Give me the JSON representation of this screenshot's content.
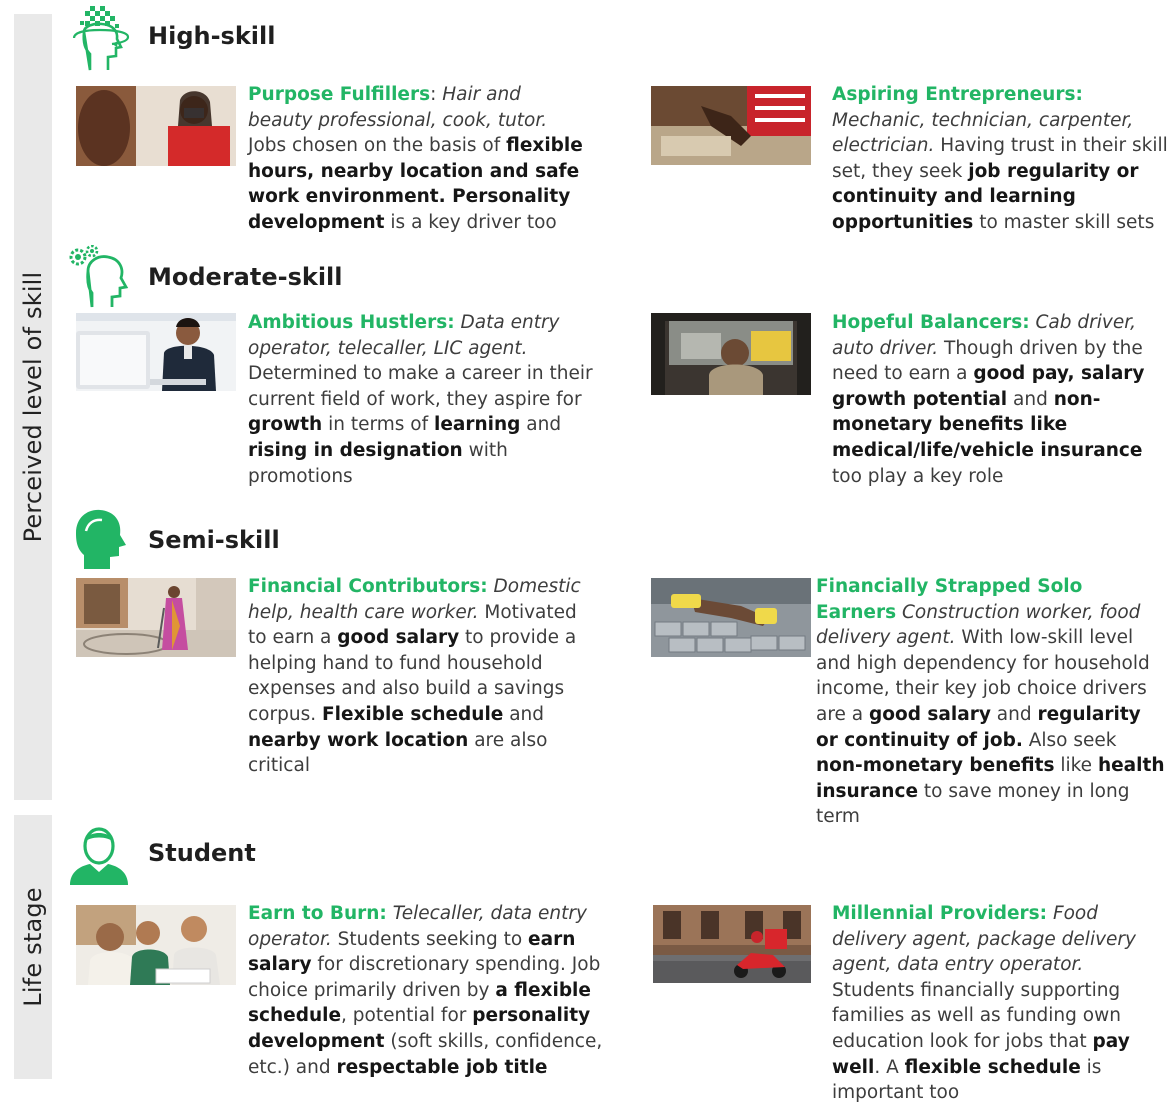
{
  "axis": {
    "skill_label": "Perceived level of skill",
    "life_label": "Life stage"
  },
  "colors": {
    "accent": "#22b565",
    "sidebar": "#e9e9e9",
    "text": "#3d3d3d"
  },
  "sections": [
    {
      "title": "High-skill",
      "icon": "head-pixel-icon",
      "cards": [
        {
          "name": "Purpose Fulfillers",
          "sep": ":",
          "examples": "Hair and beauty professional, cook, tutor.",
          "segments": [
            {
              "t": "Jobs chosen on the basis of ",
              "b": false
            },
            {
              "t": "flexible hours, nearby location and safe work environment. Personality development",
              "b": true
            },
            {
              "t": " is a key driver too",
              "b": false
            }
          ]
        },
        {
          "name": "Aspiring Entrepreneurs:",
          "sep": "",
          "examples": "Mechanic, technician, carpenter, electrician.",
          "segments": [
            {
              "t": "Having trust in their skill set, they seek ",
              "b": false
            },
            {
              "t": "job regularity or continuity and learning opportunities",
              "b": true
            },
            {
              "t": " to master skill sets",
              "b": false
            }
          ]
        }
      ]
    },
    {
      "title": "Moderate-skill",
      "icon": "head-gears-icon",
      "cards": [
        {
          "name": "Ambitious Hustlers:",
          "sep": "",
          "examples": "Data entry operator, telecaller, LIC agent.",
          "segments": [
            {
              "t": "Determined to make a career in their current field of work, they aspire for ",
              "b": false
            },
            {
              "t": "growth",
              "b": true
            },
            {
              "t": " in terms of ",
              "b": false
            },
            {
              "t": "learning",
              "b": true
            },
            {
              "t": " and ",
              "b": false
            },
            {
              "t": "rising in designation",
              "b": true
            },
            {
              "t": " with promotions",
              "b": false
            }
          ]
        },
        {
          "name": "Hopeful Balancers:",
          "sep": "",
          "examples": "Cab driver, auto driver.",
          "segments": [
            {
              "t": "Though driven by the need to earn a ",
              "b": false
            },
            {
              "t": "good pay, salary growth potential",
              "b": true
            },
            {
              "t": " and ",
              "b": false
            },
            {
              "t": "non-monetary benefits like medical/life/vehicle insurance",
              "b": true
            },
            {
              "t": " too play a key role",
              "b": false
            }
          ]
        }
      ]
    },
    {
      "title": "Semi-skill",
      "icon": "head-solid-icon",
      "cards": [
        {
          "name": "Financial Contributors:",
          "sep": "",
          "examples": "Domestic help, health care worker.",
          "segments": [
            {
              "t": "Motivated to earn a ",
              "b": false
            },
            {
              "t": "good salary",
              "b": true
            },
            {
              "t": " to provide a helping hand to fund household expenses and also build a savings corpus. ",
              "b": false
            },
            {
              "t": "Flexible schedule",
              "b": true
            },
            {
              "t": " and ",
              "b": false
            },
            {
              "t": "nearby work location",
              "b": true
            },
            {
              "t": " are also critical",
              "b": false
            }
          ]
        },
        {
          "name": "Financially Strapped Solo Earners",
          "sep": "",
          "examples": "Construction worker, food delivery agent.",
          "segments": [
            {
              "t": "With low-skill level and high dependency for household income, their key job choice drivers are a ",
              "b": false
            },
            {
              "t": "good salary",
              "b": true
            },
            {
              "t": " and ",
              "b": false
            },
            {
              "t": "regularity or continuity of job.",
              "b": true
            },
            {
              "t": " Also seek ",
              "b": false
            },
            {
              "t": "non-monetary benefits",
              "b": true
            },
            {
              "t": " like ",
              "b": false
            },
            {
              "t": "health insurance",
              "b": true
            },
            {
              "t": " to save money in long term",
              "b": false
            }
          ]
        }
      ]
    },
    {
      "title": "Student",
      "icon": "student-avatar-icon",
      "cards": [
        {
          "name": "Earn to Burn:",
          "sep": "",
          "examples": "Telecaller, data entry operator.",
          "segments": [
            {
              "t": "Students seeking to ",
              "b": false
            },
            {
              "t": "earn salary",
              "b": true
            },
            {
              "t": " for discretionary spending. Job choice primarily driven by ",
              "b": false
            },
            {
              "t": "a flexible schedule",
              "b": true
            },
            {
              "t": ", potential for ",
              "b": false
            },
            {
              "t": "personality development",
              "b": true
            },
            {
              "t": " (soft skills, confidence, etc.) and ",
              "b": false
            },
            {
              "t": "respectable job title",
              "b": true
            }
          ]
        },
        {
          "name": "Millennial Providers:",
          "sep": "",
          "examples": "Food delivery agent, package delivery agent, data entry operator.",
          "segments": [
            {
              "t": "Students financially supporting families as well as funding own education look for jobs that ",
              "b": false
            },
            {
              "t": "pay well",
              "b": true
            },
            {
              "t": ". A ",
              "b": false
            },
            {
              "t": "flexible schedule",
              "b": true
            },
            {
              "t": " is important too",
              "b": false
            }
          ]
        }
      ]
    }
  ]
}
